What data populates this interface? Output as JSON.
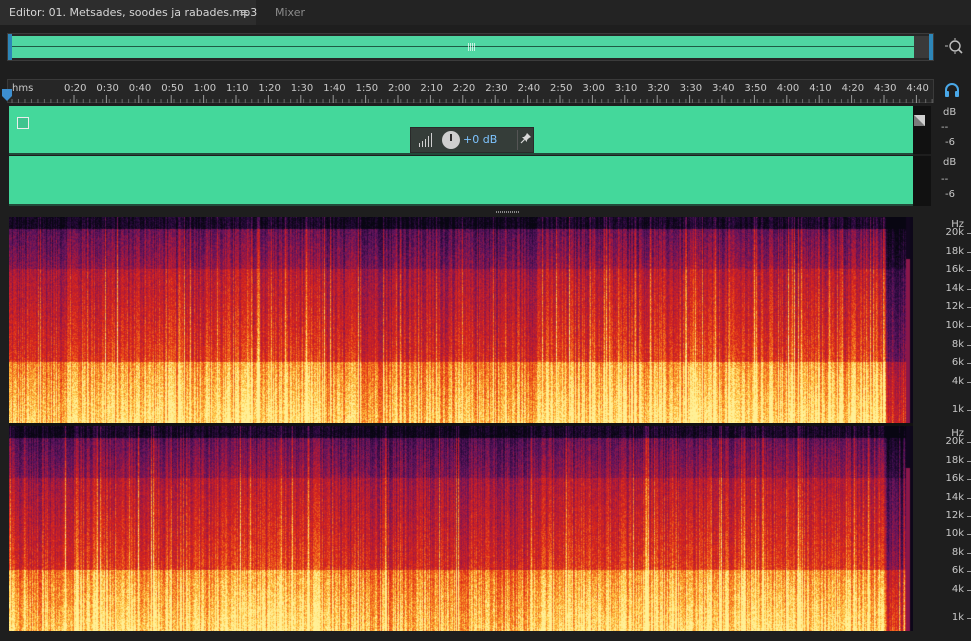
{
  "tabs": {
    "editor_label": "Editor: 01. Metsades, soodes ja rabades.mp3",
    "menu_glyph": "≡",
    "mixer_label": "Mixer"
  },
  "icons": {
    "zoom": "zoom-navigator-icon",
    "headphone": "headphone-monitor-icon",
    "clip": "clip-select-icon",
    "fade": "fade-handle-icon",
    "pin": "pin-icon"
  },
  "colors": {
    "waveform": "#44d89b",
    "accent_blue": "#2d86b8",
    "background": "#1e1e1e"
  },
  "ruler": {
    "unit": "hms",
    "ticks": [
      "0:20",
      "0:30",
      "0:40",
      "0:50",
      "1:00",
      "1:10",
      "1:20",
      "1:30",
      "1:40",
      "1:50",
      "2:00",
      "2:10",
      "2:20",
      "2:30",
      "2:40",
      "2:50",
      "3:00",
      "3:10",
      "3:20",
      "3:30",
      "3:40",
      "3:50",
      "4:00",
      "4:10",
      "4:20",
      "4:30",
      "4:40"
    ]
  },
  "hud": {
    "gain_value": "+0 dB"
  },
  "amp_scale": {
    "unit": "dB",
    "top": "--",
    "bottom": "-6"
  },
  "freq_scale": {
    "unit": "Hz",
    "labels": [
      "20k",
      "18k",
      "16k",
      "14k",
      "12k",
      "10k",
      "8k",
      "6k",
      "4k",
      "1k"
    ]
  }
}
